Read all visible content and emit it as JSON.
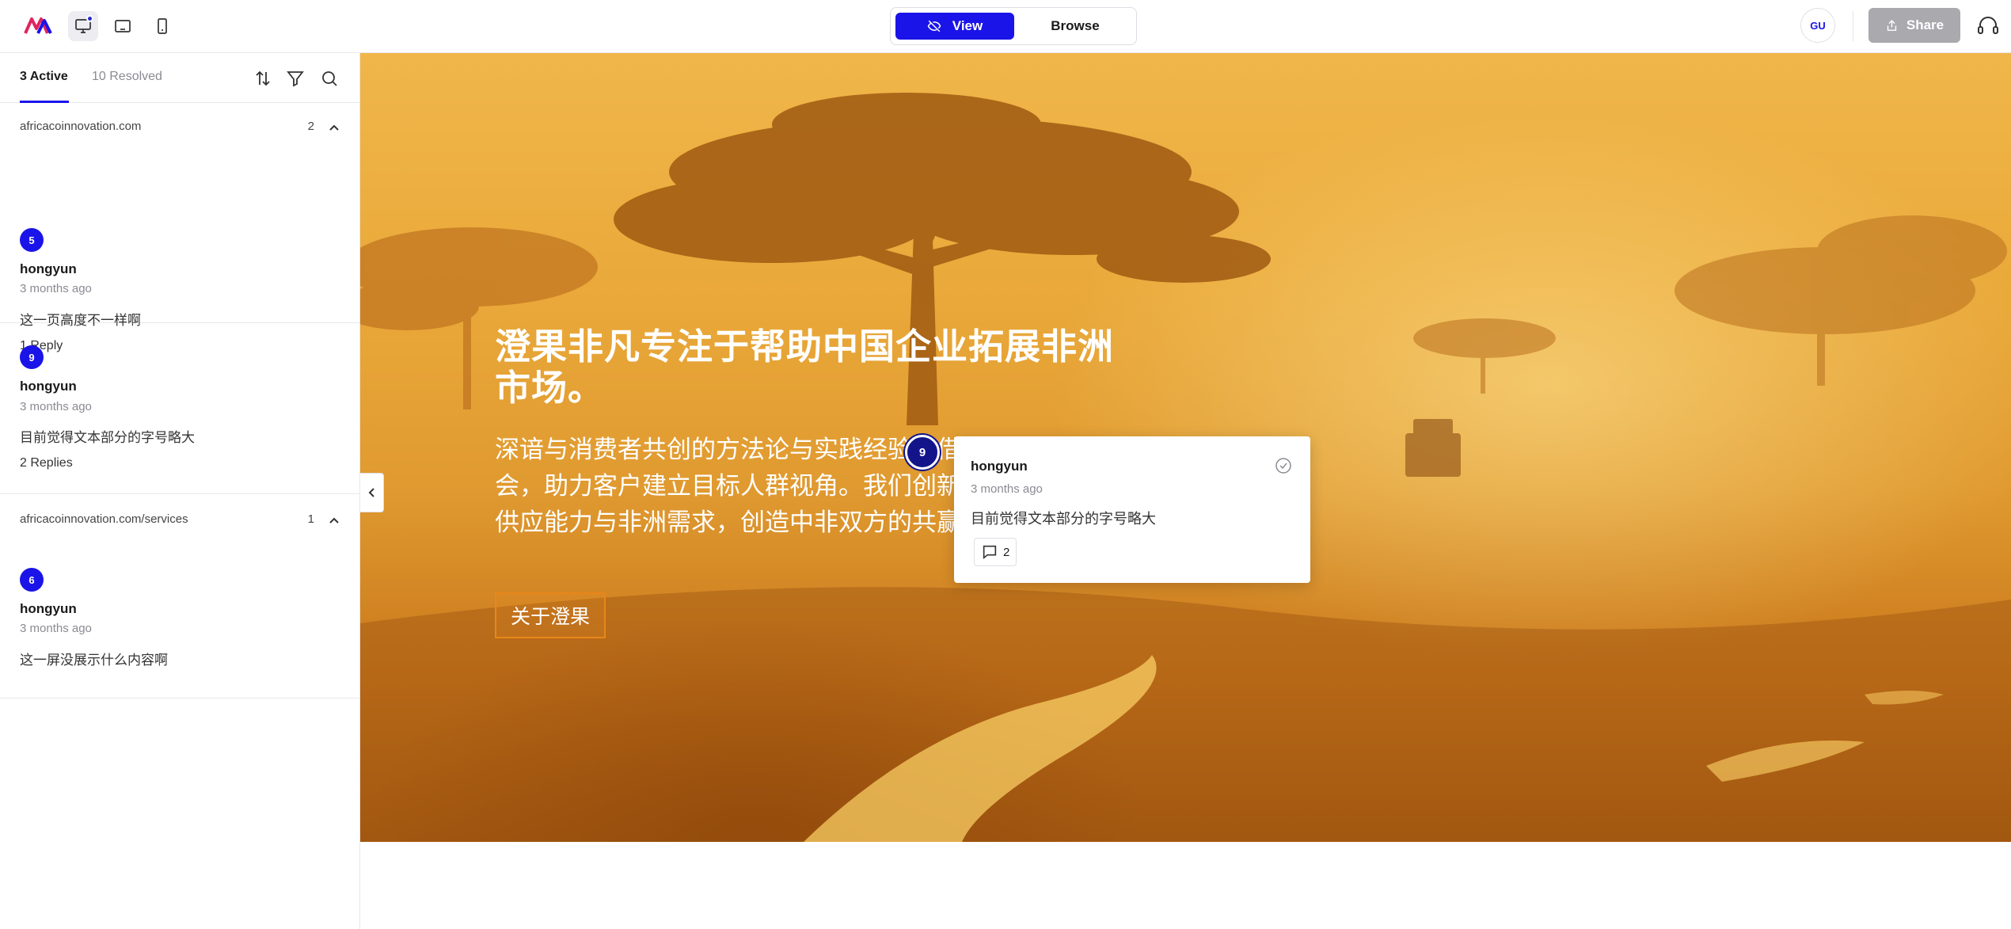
{
  "toolbar": {
    "view_label": "View",
    "browse_label": "Browse",
    "user_initials": "GU",
    "share_label": "Share"
  },
  "sidebar": {
    "tabs": {
      "active": "3  Active",
      "resolved": "10 Resolved"
    },
    "groups": [
      {
        "url": "africacoinnovation.com",
        "count": "2",
        "threads": [
          {
            "pin": "5",
            "author": "hongyun",
            "time": "3 months ago",
            "body": "这一页高度不一样啊",
            "replies": "1 Reply"
          },
          {
            "pin": "9",
            "author": "hongyun",
            "time": "3 months ago",
            "body": "目前觉得文本部分的字号略大",
            "replies": "2 Replies"
          }
        ]
      },
      {
        "url": "africacoinnovation.com/services",
        "count": "1",
        "threads": [
          {
            "pin": "6",
            "author": "hongyun",
            "time": "3 months ago",
            "body": "这一屏没展示什么内容啊"
          }
        ]
      }
    ]
  },
  "hero": {
    "title": "澄果非凡专注于帮助中国企业拓展非洲市场。",
    "description": "深谙与消费者共创的方法论与实践经验，借助\n会，助力客户建立目标人群视角。我们创新设\n供应能力与非洲需求，创造中非双方的共赢价",
    "button_label": "关于澄果"
  },
  "marker": {
    "number": "9"
  },
  "popup": {
    "author": "hongyun",
    "time": "3 months ago",
    "body": "目前觉得文本部分的字号略大",
    "reply_count": "2"
  },
  "colors": {
    "accent": "#1a14e8",
    "marker_dark": "#14148a",
    "hero_button_border": "#e9861a",
    "share_disabled": "#a9a9ae"
  },
  "icons": [
    "logo",
    "desktop-icon",
    "tablet-icon",
    "mobile-icon",
    "eye-off-icon",
    "share-icon",
    "headset-icon",
    "sort-icon",
    "filter-icon",
    "search-icon",
    "chevron-up-icon",
    "chevron-left-icon",
    "check-circle-icon",
    "comment-icon"
  ]
}
